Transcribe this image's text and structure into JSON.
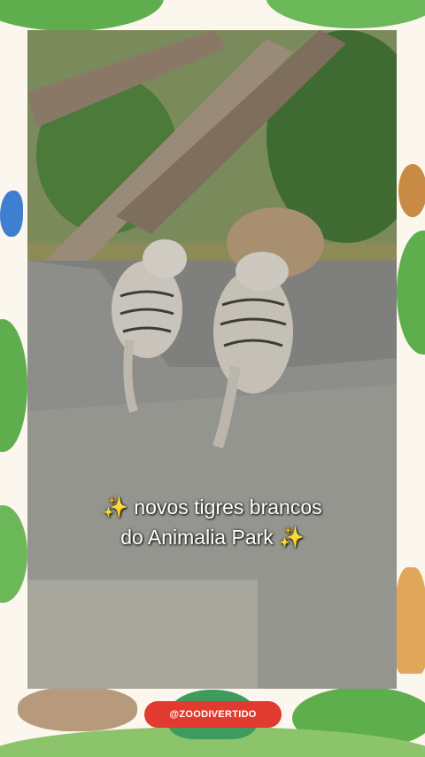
{
  "caption": {
    "line1_sparkle": "✨",
    "line1_text": "novos tigres brancos",
    "line2_text": "do Animalia Park",
    "line2_sparkle": "✨"
  },
  "badge": {
    "handle": "@ZOODIVERTIDO"
  },
  "colors": {
    "badge": "#e03b2e",
    "frame_bg": "#fbf6ee",
    "leaf": "#5fae4d"
  }
}
